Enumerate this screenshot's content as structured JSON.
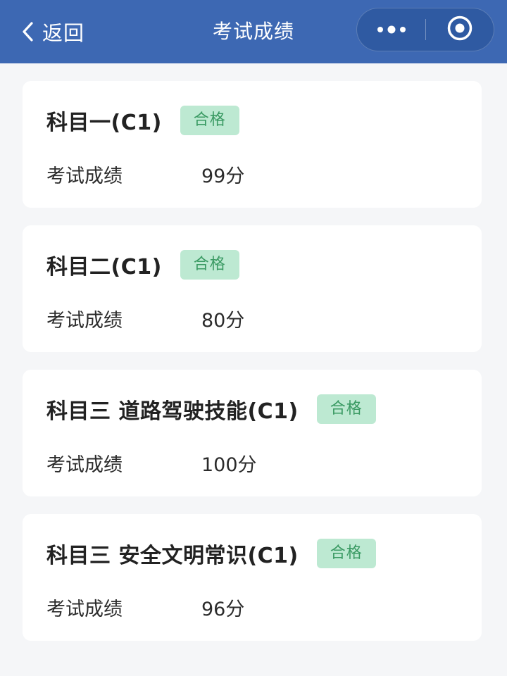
{
  "header": {
    "back_label": "返回",
    "title": "考试成绩",
    "back_icon": "chevron-left-icon",
    "more_icon": "more-dots-icon",
    "target_icon": "target-icon"
  },
  "colors": {
    "navbar": "#3d68b3",
    "page_bg": "#f5f6f8",
    "badge_bg": "#bde9d2",
    "badge_text": "#3a9a63"
  },
  "results": [
    {
      "subject": "科目一(C1)",
      "status": "合格",
      "score_label": "考试成绩",
      "score": "99分"
    },
    {
      "subject": "科目二(C1)",
      "status": "合格",
      "score_label": "考试成绩",
      "score": "80分"
    },
    {
      "subject": "科目三 道路驾驶技能(C1)",
      "status": "合格",
      "score_label": "考试成绩",
      "score": "100分"
    },
    {
      "subject": "科目三 安全文明常识(C1)",
      "status": "合格",
      "score_label": "考试成绩",
      "score": "96分"
    }
  ]
}
